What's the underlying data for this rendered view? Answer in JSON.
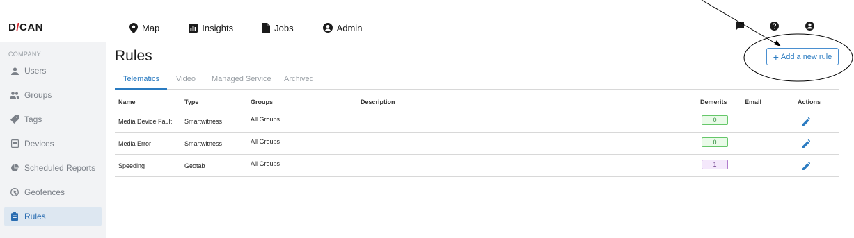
{
  "app": {
    "logo_left": "D",
    "logo_accent": "/",
    "logo_right": "CAN"
  },
  "topnav": {
    "items": [
      {
        "label": "Map",
        "icon": "map-pin-icon"
      },
      {
        "label": "Insights",
        "icon": "bar-chart-icon"
      },
      {
        "label": "Jobs",
        "icon": "document-icon"
      },
      {
        "label": "Admin",
        "icon": "user-circle-icon"
      }
    ],
    "right_icons": [
      "chat-icon",
      "help-icon",
      "account-icon"
    ]
  },
  "sidebar": {
    "section": "COMPANY",
    "items": [
      {
        "label": "Users",
        "icon": "person-icon"
      },
      {
        "label": "Groups",
        "icon": "people-icon"
      },
      {
        "label": "Tags",
        "icon": "tag-icon"
      },
      {
        "label": "Devices",
        "icon": "device-icon"
      },
      {
        "label": "Scheduled Reports",
        "icon": "pie-chart-icon"
      },
      {
        "label": "Geofences",
        "icon": "globe-icon"
      },
      {
        "label": "Rules",
        "icon": "clipboard-icon",
        "active": true
      }
    ]
  },
  "main": {
    "title": "Rules",
    "add_button": "Add a new rule",
    "tabs": [
      {
        "label": "Telematics",
        "active": true
      },
      {
        "label": "Video"
      },
      {
        "label": "Managed Service"
      },
      {
        "label": "Archived"
      }
    ],
    "table": {
      "columns": [
        "Name",
        "Type",
        "Groups",
        "Description",
        "Demerits",
        "Email",
        "Actions"
      ],
      "rows": [
        {
          "name": "Media Device Fault",
          "type": "Smartwitness",
          "groups": "All Groups",
          "description": "",
          "demerits": "0",
          "email": "",
          "badge_color": "green"
        },
        {
          "name": "Media Error",
          "type": "Smartwitness",
          "groups": "All Groups",
          "description": "",
          "demerits": "0",
          "email": "",
          "badge_color": "green"
        },
        {
          "name": "Speeding",
          "type": "Geotab",
          "groups": "All Groups",
          "description": "",
          "demerits": "1",
          "email": "",
          "badge_color": "purple"
        }
      ]
    }
  },
  "colors": {
    "accent": "#2a7bc1",
    "logo_accent": "#d8262e",
    "sidebar_bg": "#f2f3f5",
    "active_bg": "#dde7f1"
  }
}
